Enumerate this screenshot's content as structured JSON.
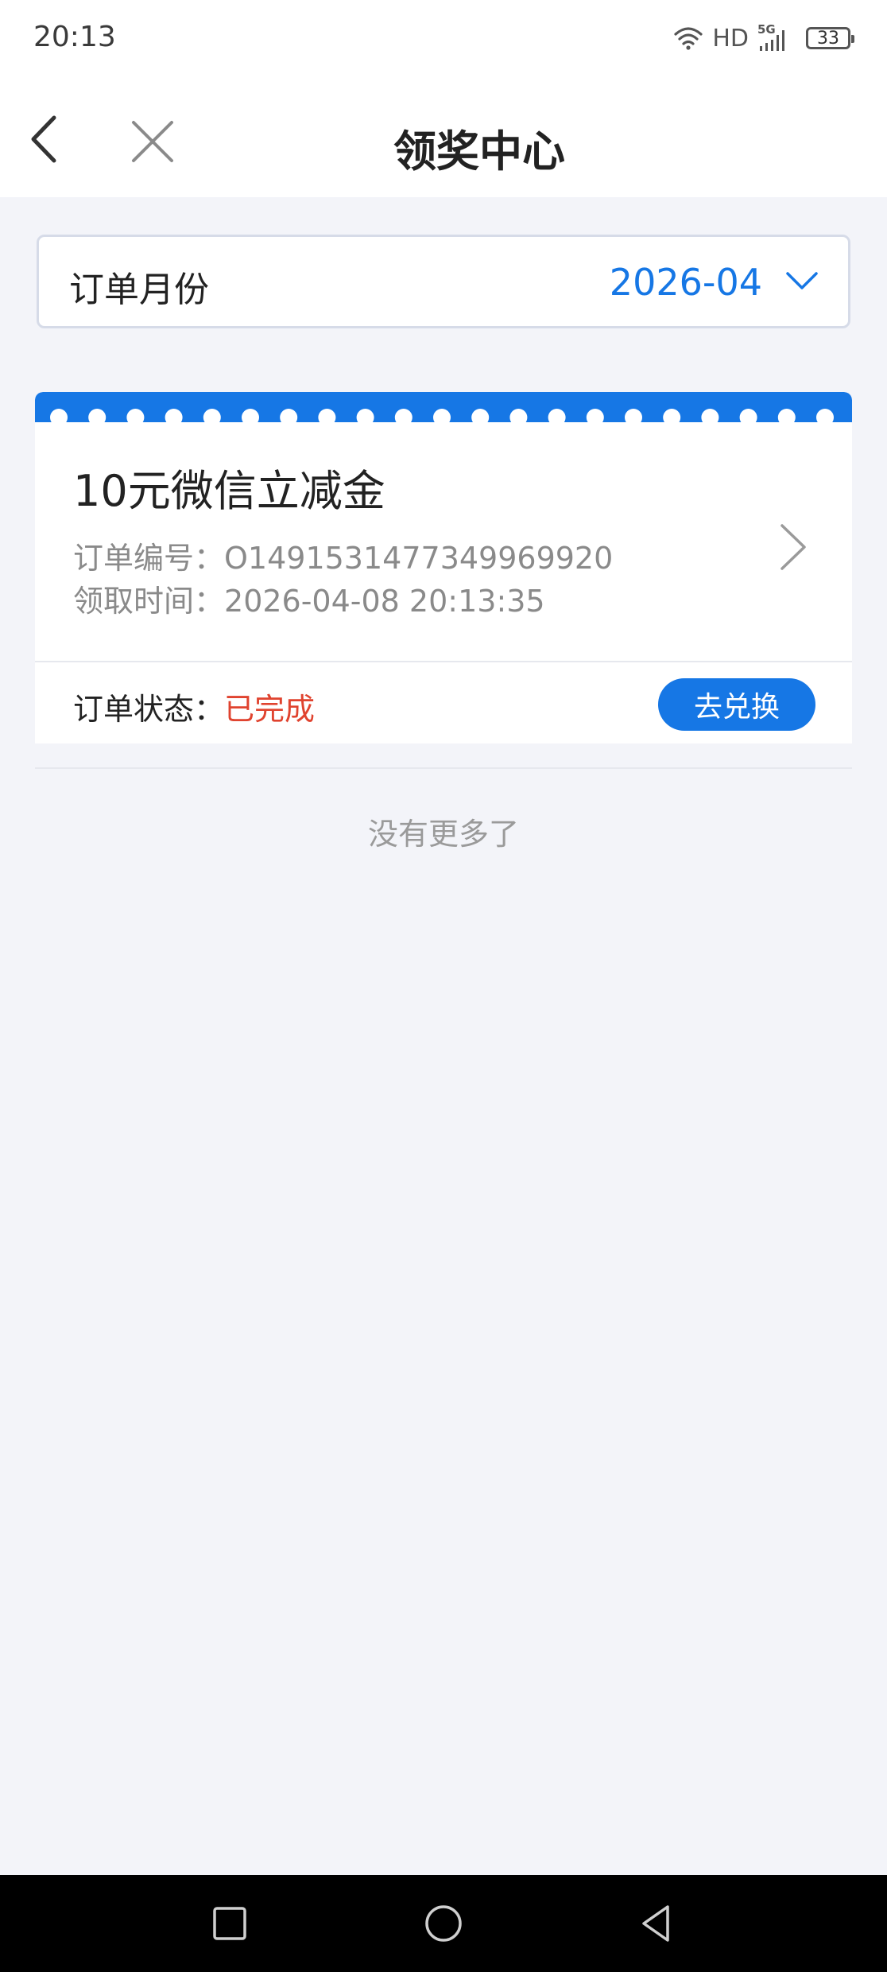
{
  "status_bar": {
    "time": "20:13",
    "network_label": "HD",
    "signal_label": "5G",
    "battery": "33"
  },
  "header": {
    "title": "领奖中心",
    "back_icon": "chevron-left-icon",
    "close_icon": "close-icon"
  },
  "month_filter": {
    "label": "订单月份",
    "value": "2026-04",
    "icon": "chevron-down-icon"
  },
  "orders": [
    {
      "title": "10元微信立减金",
      "order_number_label": "订单编号：",
      "order_number": "O1491531477349969920",
      "claim_time_label": "领取时间：",
      "claim_time": "2026-04-08 20:13:35",
      "status_label": "订单状态：",
      "status": "已完成",
      "action_label": "去兑换"
    }
  ],
  "list_footer": "没有更多了",
  "colors": {
    "accent": "#1677e5",
    "status_done": "#e0432f",
    "background": "#f3f4f9"
  }
}
